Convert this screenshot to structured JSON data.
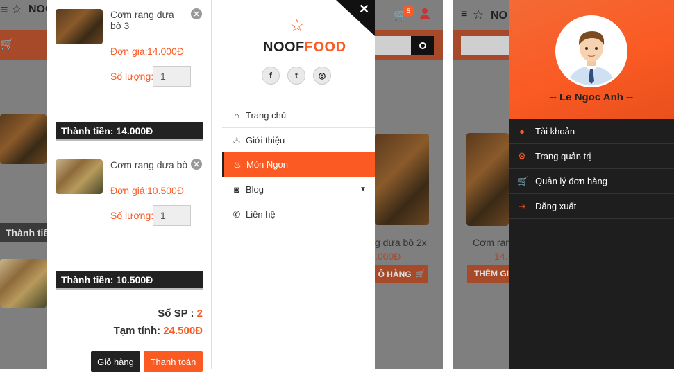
{
  "brand": {
    "part1": "NOOF",
    "part2": "FOOD",
    "short": "NOC"
  },
  "cart": {
    "items": [
      {
        "name": "Cơm rang dưa bò 3",
        "price_label": "Đơn giá:",
        "price": "14.000Đ",
        "qty_label": "Số lượng:",
        "qty": "1",
        "subtotal": "Thành tiền: 14.000Đ"
      },
      {
        "name": "Cơm rang dưa bò",
        "price_label": "Đơn giá:",
        "price": "10.500Đ",
        "qty_label": "Số lượng:",
        "qty": "1",
        "subtotal": "Thành tiền: 10.500Đ"
      }
    ],
    "count_label": "Số SP :",
    "count": "2",
    "total_label": "Tạm tính:",
    "total": "24.500Đ",
    "cart_button": "Giỏ hàng",
    "checkout_button": "Thanh toán"
  },
  "nav": {
    "items": [
      {
        "label": "Trang chủ",
        "icon": "home-icon"
      },
      {
        "label": "Giới thiệu",
        "icon": "cake-icon"
      },
      {
        "label": "Món Ngon",
        "icon": "cake-icon",
        "active": true
      },
      {
        "label": "Blog",
        "icon": "rss-icon"
      },
      {
        "label": "Liên hệ",
        "icon": "phone-icon"
      }
    ]
  },
  "background_page": {
    "cart_badge": "5",
    "product_name": "g dưa bò 2x",
    "product_price": ".000Đ",
    "add_button": "Ô HÀNG",
    "subtotal_peek": "Thành tiề",
    "right_product_name": "Cơm rang",
    "right_product_price": "14.",
    "right_add_button": "THÊM GI"
  },
  "user": {
    "name": "-- Le Ngoc Anh --",
    "menu": [
      {
        "label": "Tài khoản",
        "icon": "user-icon"
      },
      {
        "label": "Trang quản trị",
        "icon": "gears-icon"
      },
      {
        "label": "Quản lý đơn hàng",
        "icon": "cart-icon"
      },
      {
        "label": "Đăng xuất",
        "icon": "sign-out-icon"
      }
    ]
  },
  "colors": {
    "accent": "#fb5a23",
    "dark": "#222222"
  }
}
